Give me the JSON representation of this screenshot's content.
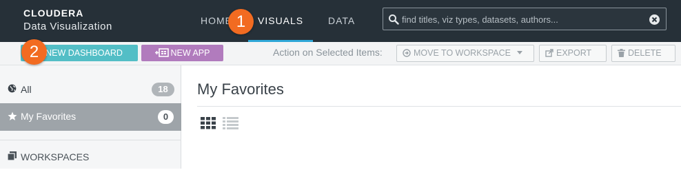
{
  "header": {
    "logo": "CLOUDERA",
    "subtitle": "Data Visualization",
    "tabs": [
      {
        "label": "HOME"
      },
      {
        "label": "VISUALS"
      },
      {
        "label": "DATA"
      }
    ],
    "active_tab": "VISUALS",
    "search": {
      "placeholder": "find titles, viz types, datasets, authors..."
    }
  },
  "callouts": [
    "1",
    "2"
  ],
  "toolbar": {
    "new_dashboard": "NEW DASHBOARD",
    "new_app": "NEW APP",
    "action_label": "Action on Selected Items:",
    "move": "MOVE TO WORKSPACE",
    "export": "EXPORT",
    "delete": "DELETE"
  },
  "sidebar": {
    "items": [
      {
        "label": "All",
        "count": "18",
        "icon": "globe-icon"
      },
      {
        "label": "My Favorites",
        "count": "0",
        "icon": "star-icon"
      }
    ],
    "workspaces": "WORKSPACES"
  },
  "main": {
    "title": "My Favorites"
  },
  "colors": {
    "header_bg": "#263038",
    "accent": "#2fa8d8",
    "callout": "#f26b21",
    "dashboard_btn": "#53bec6",
    "app_btn": "#b17bbd",
    "selected_item": "#9ea4a9"
  }
}
